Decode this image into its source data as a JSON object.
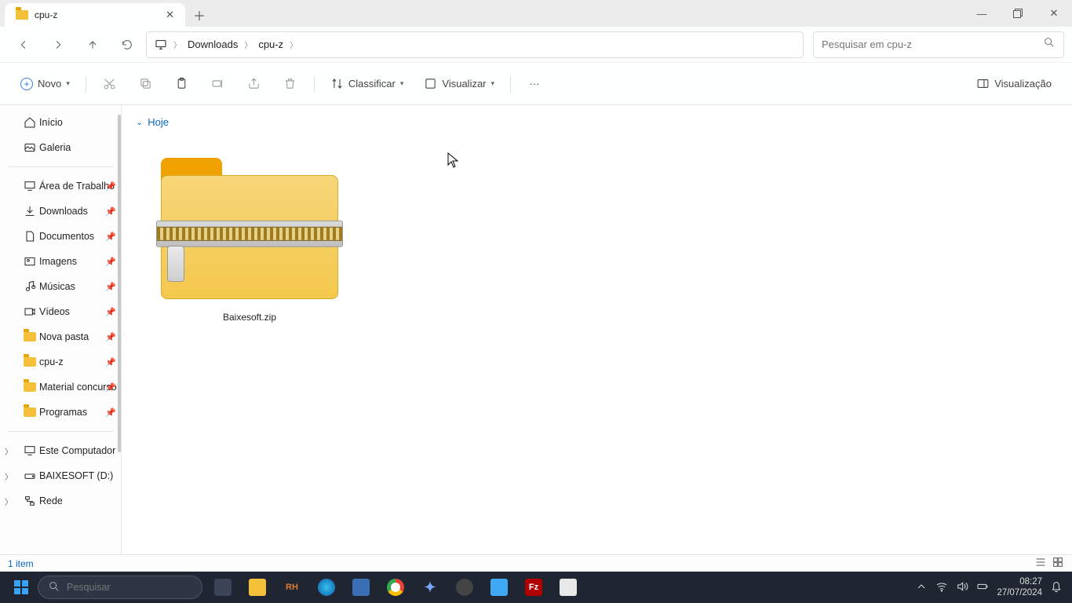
{
  "window": {
    "tab_title": "cpu-z",
    "controls": {
      "min": "—",
      "close": "✕"
    }
  },
  "nav": {
    "crumbs": [
      "Downloads",
      "cpu-z"
    ],
    "search_placeholder": "Pesquisar em cpu-z"
  },
  "toolbar": {
    "new": "Novo",
    "sort": "Classificar",
    "view": "Visualizar",
    "more": "···",
    "preview": "Visualização"
  },
  "sidebar": {
    "top": [
      {
        "label": "Início",
        "icon": "home"
      },
      {
        "label": "Galeria",
        "icon": "gallery"
      }
    ],
    "pinned": [
      {
        "label": "Área de Trabalho",
        "icon": "desktop"
      },
      {
        "label": "Downloads",
        "icon": "download"
      },
      {
        "label": "Documentos",
        "icon": "document"
      },
      {
        "label": "Imagens",
        "icon": "image"
      },
      {
        "label": "Músicas",
        "icon": "music"
      },
      {
        "label": "Vídeos",
        "icon": "video"
      },
      {
        "label": "Nova pasta",
        "icon": "folder"
      },
      {
        "label": "cpu-z",
        "icon": "folder"
      },
      {
        "label": "Material concurso",
        "icon": "folder"
      },
      {
        "label": "Programas",
        "icon": "folder"
      }
    ],
    "expandable": [
      {
        "label": "Este Computador",
        "icon": "pc"
      },
      {
        "label": "BAIXESOFT (D:)",
        "icon": "drive"
      },
      {
        "label": "Rede",
        "icon": "network"
      }
    ]
  },
  "content": {
    "group_today": "Hoje",
    "files": [
      {
        "name": "Baixesoft.zip",
        "type": "zip"
      }
    ]
  },
  "statusbar": {
    "count_text": "1 item"
  },
  "taskbar": {
    "search_placeholder": "Pesquisar",
    "clock_time": "08:27",
    "clock_date": "27/07/2024"
  }
}
